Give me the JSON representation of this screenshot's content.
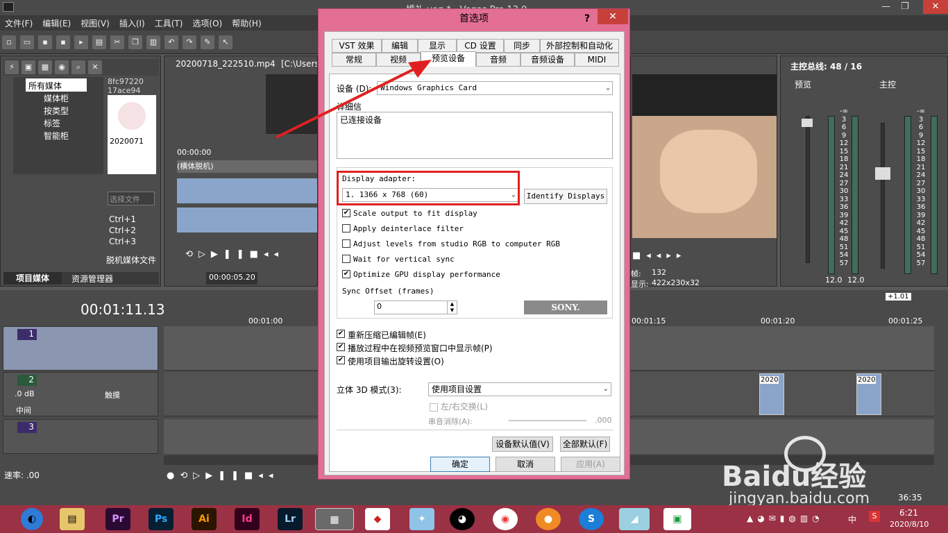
{
  "app": {
    "title": "婚礼.veg * - Vegas Pro 13.0",
    "menu": [
      "文件(F)",
      "编辑(E)",
      "视图(V)",
      "插入(I)",
      "工具(T)",
      "选项(O)",
      "帮助(H)"
    ],
    "explorer": {
      "tree": [
        "所有媒体",
        "媒体柜",
        "按类型",
        "标签",
        "智能柜"
      ],
      "thumb_id": "8fc97220\n17ace94",
      "thumb_name": "2020071",
      "search_placeholder": "选择文件",
      "shortcuts": [
        "Ctrl+1",
        "Ctrl+2",
        "Ctrl+3"
      ],
      "bottom_label": "脱机媒体文件",
      "tabs": [
        "项目媒体",
        "资源管理器"
      ]
    },
    "trimmer": {
      "file": "20200718_222510.mp4",
      "path": "[C:\\Users\\",
      "time": "00:00:00",
      "clip_label": "(横体脱机)",
      "position": "00:00:05.20"
    },
    "preview": {
      "frame_label": "帧:",
      "frame_value": "132",
      "display_label": "显示:",
      "display_value": "422x230x32"
    },
    "mixer": {
      "title": "主控总线: 48 / 16",
      "preview_label": "预览",
      "master_label": "主控",
      "scale": [
        "-∞",
        "3",
        "6",
        "9",
        "12",
        "15",
        "18",
        "21",
        "24",
        "27",
        "30",
        "33",
        "36",
        "39",
        "42",
        "45",
        "48",
        "51",
        "54",
        "57"
      ],
      "value_left": "12.0",
      "value_right": "12.0"
    },
    "timeline": {
      "time": "00:01:11.13",
      "rate_value": "+1.01",
      "marks": [
        "00:01:00",
        "00:01:15",
        "00:01:20",
        "00:01:25"
      ],
      "tracks": [
        {
          "num": "1"
        },
        {
          "num": "2",
          "db": ".0 dB",
          "pan": "中间",
          "mode": "触摸"
        },
        {
          "num": "3"
        }
      ],
      "rate": "速率: .00",
      "clip_label": "2020",
      "clip_end": "36:35"
    }
  },
  "dialog": {
    "title": "首选项",
    "help": "?",
    "close": "✕",
    "tabs_row1": [
      "VST 效果",
      "编辑",
      "显示",
      "CD 设置",
      "同步",
      "外部控制和自动化"
    ],
    "tabs_row2": [
      "常规",
      "视频",
      "预览设备",
      "音频",
      "音频设备",
      "MIDI"
    ],
    "device_label": "设备 (D):",
    "device_value": "Windows Graphics Card",
    "details_label": "详细信",
    "details_text": "已连接设备",
    "adapter_label": "Display adapter:",
    "adapter_value": "1. 1366 x 768 (60)",
    "identify_button": "Identify Displays",
    "options": [
      {
        "label": "Scale output to fit display",
        "checked": true
      },
      {
        "label": "Apply deinterlace filter",
        "checked": false
      },
      {
        "label": "Adjust levels from studio RGB to computer RGB",
        "checked": false
      },
      {
        "label": "Wait for vertical sync",
        "checked": false
      },
      {
        "label": "Optimize GPU display performance",
        "checked": true
      }
    ],
    "sync_label": "Sync Offset (frames)",
    "sync_value": "0",
    "sony": "SONY.",
    "cn_options": [
      {
        "label": "重新压缩已编辑帧(E)",
        "checked": true
      },
      {
        "label": "播放过程中在视频预览窗口中显示帧(P)",
        "checked": true
      },
      {
        "label": "使用项目输出旋转设置(O)",
        "checked": true
      }
    ],
    "stereo_label": "立体 3D 模式(3):",
    "stereo_value": "使用项目设置",
    "swap_label": "左/右交换(L)",
    "crosstalk_label": "串音消除(A):",
    "crosstalk_value": ".000",
    "device_defaults": "设备默认值(V)",
    "all_defaults": "全部默认(F)",
    "ok": "确定",
    "cancel": "取消",
    "apply": "应用(A)"
  },
  "taskbar": {
    "apps": [
      "Pr",
      "Ps",
      "Ai",
      "Id",
      "Lr"
    ],
    "time": "6:21",
    "date": "2020/8/10",
    "ime": "中"
  },
  "watermark": {
    "brand": "Baidu经验",
    "url": "jingyan.baidu.com"
  },
  "annotation_color": "#e02020"
}
